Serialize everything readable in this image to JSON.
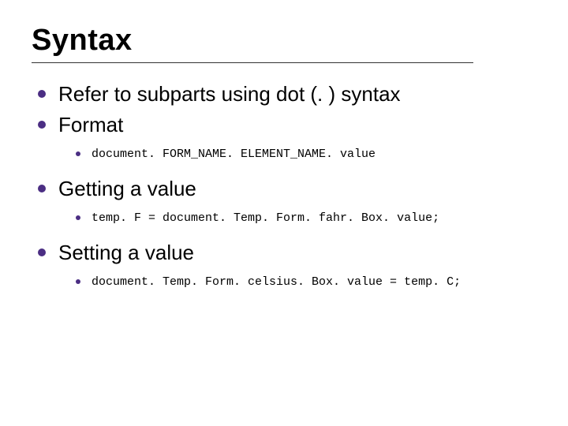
{
  "title": "Syntax",
  "bullets": [
    {
      "text": "Refer to subparts using dot (. ) syntax"
    },
    {
      "text": "Format",
      "sub": [
        {
          "code": "document. FORM_NAME. ELEMENT_NAME. value"
        }
      ]
    },
    {
      "text": "Getting a value",
      "sub": [
        {
          "code": "temp. F = document. Temp. Form. fahr. Box. value;"
        }
      ]
    },
    {
      "text": "Setting a value",
      "sub": [
        {
          "code": "document. Temp. Form. celsius. Box. value = temp. C;"
        }
      ]
    }
  ]
}
